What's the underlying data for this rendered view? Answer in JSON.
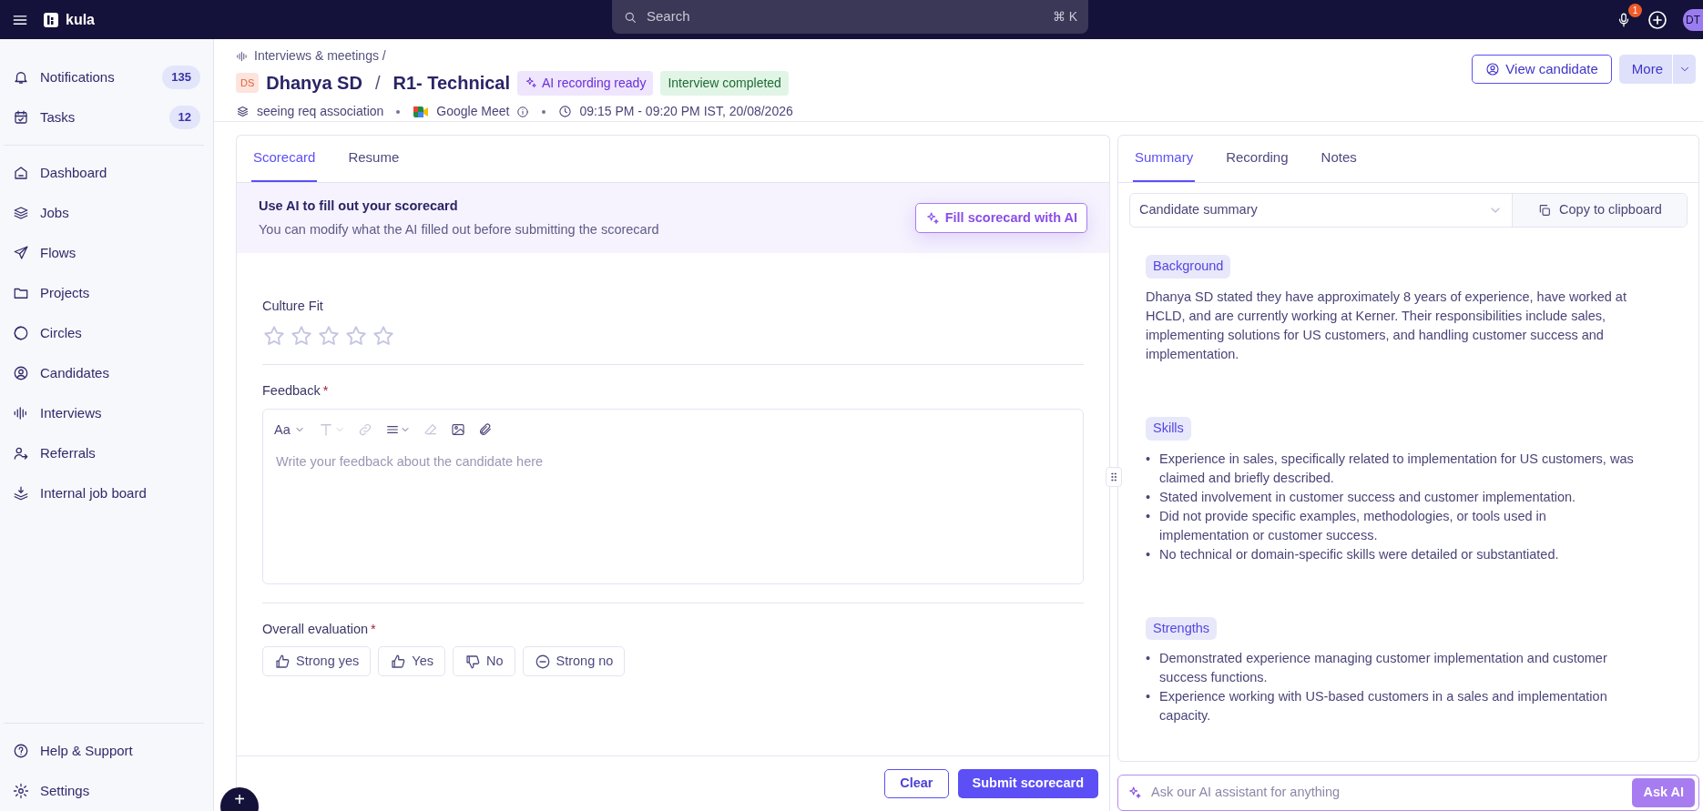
{
  "topbar": {
    "logo": "kula",
    "search": {
      "placeholder": "Search",
      "shortcut": "⌘ K"
    },
    "notification_count": "1",
    "avatar": "DT"
  },
  "sidebar": {
    "top_items": [
      {
        "label": "Notifications",
        "count": "135"
      },
      {
        "label": "Tasks",
        "count": "12"
      }
    ],
    "nav_items": [
      {
        "label": "Dashboard"
      },
      {
        "label": "Jobs"
      },
      {
        "label": "Flows"
      },
      {
        "label": "Projects"
      },
      {
        "label": "Circles"
      },
      {
        "label": "Candidates"
      },
      {
        "label": "Interviews"
      },
      {
        "label": "Referrals"
      },
      {
        "label": "Internal job board"
      }
    ],
    "bottom_items": [
      {
        "label": "Help & Support"
      },
      {
        "label": "Settings"
      }
    ]
  },
  "header": {
    "breadcrumb": "Interviews & meetings /",
    "avatar": "DS",
    "name": "Dhanya SD",
    "separator": "/",
    "round": "R1- Technical",
    "badges": [
      {
        "label": "AI recording ready",
        "kind": "ai"
      },
      {
        "label": "Interview completed",
        "kind": "success"
      }
    ],
    "meta": [
      {
        "text": "seeing req association",
        "kind": "req"
      },
      {
        "text": "Google Meet",
        "kind": "meet"
      },
      {
        "text": "09:15 PM - 09:20 PM IST, 20/08/2026",
        "kind": "time"
      }
    ],
    "actions": {
      "view_candidate": "View candidate",
      "more": "More"
    }
  },
  "scorecard_panel": {
    "tabs": [
      {
        "label": "Scorecard",
        "selected": true
      },
      {
        "label": "Resume",
        "selected": false
      }
    ],
    "ai_banner": {
      "title": "Use AI to fill out your scorecard",
      "subtitle": "You can modify what the AI filled out before submitting the scorecard",
      "button": "Fill scorecard with AI"
    },
    "culture_fit": {
      "label": "Culture Fit",
      "stars": 0
    },
    "feedback": {
      "label": "Feedback",
      "required_mark": "*",
      "font_menu": "Aa",
      "placeholder": "Write your feedback about the candidate here"
    },
    "evaluation": {
      "label": "Overall evaluation",
      "required_mark": "*",
      "options": [
        {
          "label": "Strong yes",
          "kind": "strong_yes",
          "selected": false
        },
        {
          "label": "Yes",
          "kind": "yes",
          "selected": false
        },
        {
          "label": "No",
          "kind": "no",
          "selected": false
        },
        {
          "label": "Strong no",
          "kind": "strong_no",
          "selected": false
        }
      ]
    },
    "clear_button": "Clear",
    "submit_button": "Submit scorecard"
  },
  "fab": "+",
  "summary_panel": {
    "tabs": [
      {
        "label": "Summary",
        "selected": true
      },
      {
        "label": "Recording",
        "selected": false
      },
      {
        "label": "Notes",
        "selected": false
      }
    ],
    "select": "Candidate summary",
    "copy_button": "Copy to clipboard",
    "sections": [
      {
        "heading": "Background",
        "kind": "paragraph",
        "text": "Dhanya SD stated they have approximately 8 years of experience, have worked at HCLD, and are currently working at Kerner. Their responsibilities include sales, implementing solutions for US customers, and handling customer success and implementation."
      },
      {
        "heading": "Skills",
        "kind": "list",
        "marker": "•",
        "items": [
          "Experience in sales, specifically related to implementation for US customers, was claimed and briefly described.",
          "Stated involvement in customer success and customer implementation.",
          "Did not provide specific examples, methodologies, or tools used in implementation or customer success.",
          "No technical or domain-specific skills were detailed or substantiated."
        ]
      },
      {
        "heading": "Strengths",
        "kind": "list",
        "marker": "•",
        "items": [
          "Demonstrated experience managing customer implementation and customer success functions.",
          "Experience working with US-based customers in a sales and implementation capacity."
        ]
      }
    ]
  },
  "assistant": {
    "placeholder": "Ask our AI assistant for anything",
    "button": "Ask AI"
  }
}
